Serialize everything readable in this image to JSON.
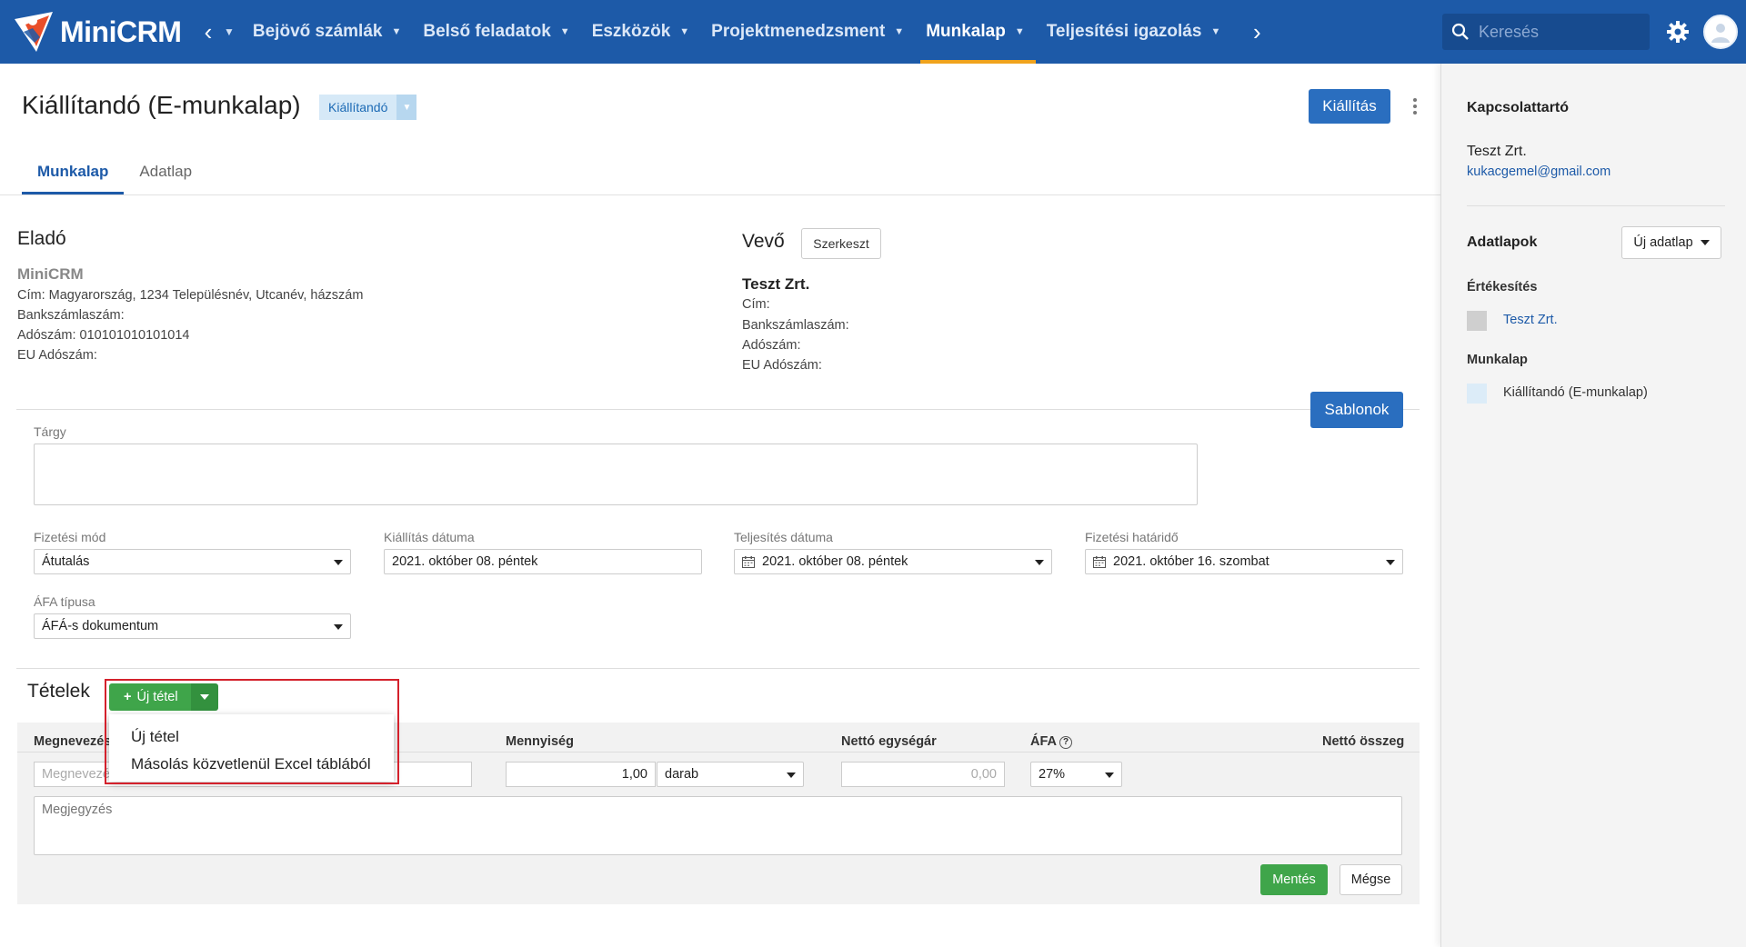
{
  "topbar": {
    "brand": "MiniCRM",
    "nav": [
      {
        "label": "Bejövő számlák",
        "active": false
      },
      {
        "label": "Belső feladatok",
        "active": false
      },
      {
        "label": "Eszközök",
        "active": false
      },
      {
        "label": "Projektmenedzsment",
        "active": false
      },
      {
        "label": "Munkalap",
        "active": true
      },
      {
        "label": "Teljesítési igazolás",
        "active": false
      }
    ],
    "search_placeholder": "Keresés",
    "accent_color": "#f0a31d",
    "bar_color": "#1d5aa8"
  },
  "header": {
    "title": "Kiállítandó (E-munkalap)",
    "status": "Kiállítandó",
    "issue_button": "Kiállítás"
  },
  "tabs": [
    {
      "label": "Munkalap",
      "active": true
    },
    {
      "label": "Adatlap",
      "active": false
    }
  ],
  "seller": {
    "heading": "Eladó",
    "name": "MiniCRM",
    "address": "Cím: Magyarország, 1234 Településnév, Utcanév, házszám",
    "bank": "Bankszámlaszám:",
    "tax": "Adószám: 010101010101014",
    "eu_tax": "EU Adószám:"
  },
  "buyer": {
    "heading": "Vevő",
    "edit_button": "Szerkeszt",
    "name": "Teszt Zrt.",
    "address": "Cím:",
    "bank": "Bankszámlaszám:",
    "tax": "Adószám:",
    "eu_tax": "EU Adószám:"
  },
  "form": {
    "subject_label": "Tárgy",
    "subject_value": "",
    "templates_button": "Sablonok",
    "payment_method_label": "Fizetési mód",
    "payment_method_value": "Átutalás",
    "issue_date_label": "Kiállítás dátuma",
    "issue_date_value": "2021. október 08. péntek",
    "fulfillment_date_label": "Teljesítés dátuma",
    "fulfillment_date_value": "2021. október 08. péntek",
    "due_date_label": "Fizetési határidő",
    "due_date_value": "2021. október 16. szombat",
    "vat_type_label": "ÁFA típusa",
    "vat_type_value": "ÁFÁ-s dokumentum"
  },
  "items": {
    "heading": "Tételek",
    "new_item_button": "Új tétel",
    "menu": [
      "Új tétel",
      "Másolás közvetlenül Excel táblából"
    ],
    "columns": {
      "name": "Megnevezés",
      "quantity": "Mennyiség",
      "unit_price": "Nettó egységár",
      "vat": "ÁFA",
      "net_total": "Nettó összeg"
    },
    "row": {
      "name_placeholder": "Megnevezés",
      "quantity": "1,00",
      "unit": "darab",
      "unit_price_placeholder": "0,00",
      "vat": "27%"
    },
    "note_placeholder": "Megjegyzés",
    "save_button": "Mentés",
    "cancel_button": "Mégse"
  },
  "sidebar": {
    "contact_heading": "Kapcsolattartó",
    "contact_name": "Teszt Zrt.",
    "contact_email": "kukacgemel@gmail.com",
    "datasheets_heading": "Adatlapok",
    "new_datasheet_button": "Új adatlap",
    "sales_heading": "Értékesítés",
    "sales_item": "Teszt Zrt.",
    "worksheet_heading": "Munkalap",
    "worksheet_item": "Kiállítandó (E-munkalap)"
  }
}
